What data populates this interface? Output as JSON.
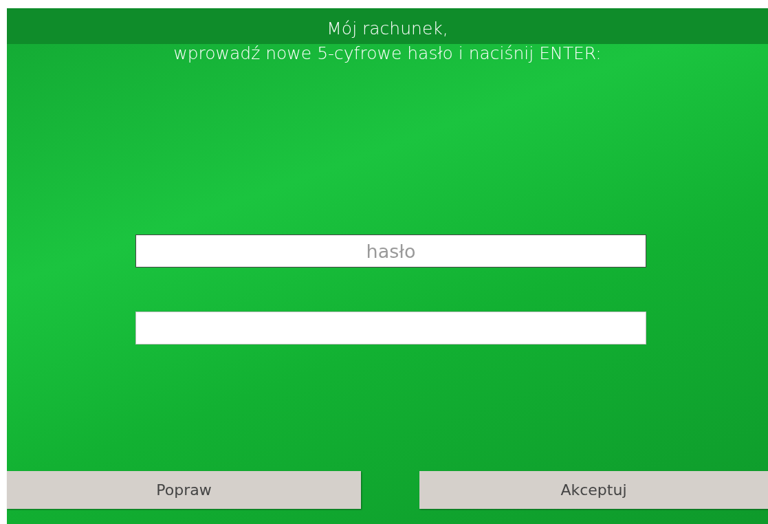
{
  "header": {
    "title": "Mój rachunek,",
    "instruction": "wprowadź nowe 5-cyfrowe hasło i naciśnij ENTER:"
  },
  "fields": [
    {
      "placeholder": "hasło",
      "focused": true
    },
    {
      "focused": false
    }
  ],
  "buttons": [
    {
      "label": "Popraw"
    },
    {
      "label": "Akceptuj"
    }
  ]
}
